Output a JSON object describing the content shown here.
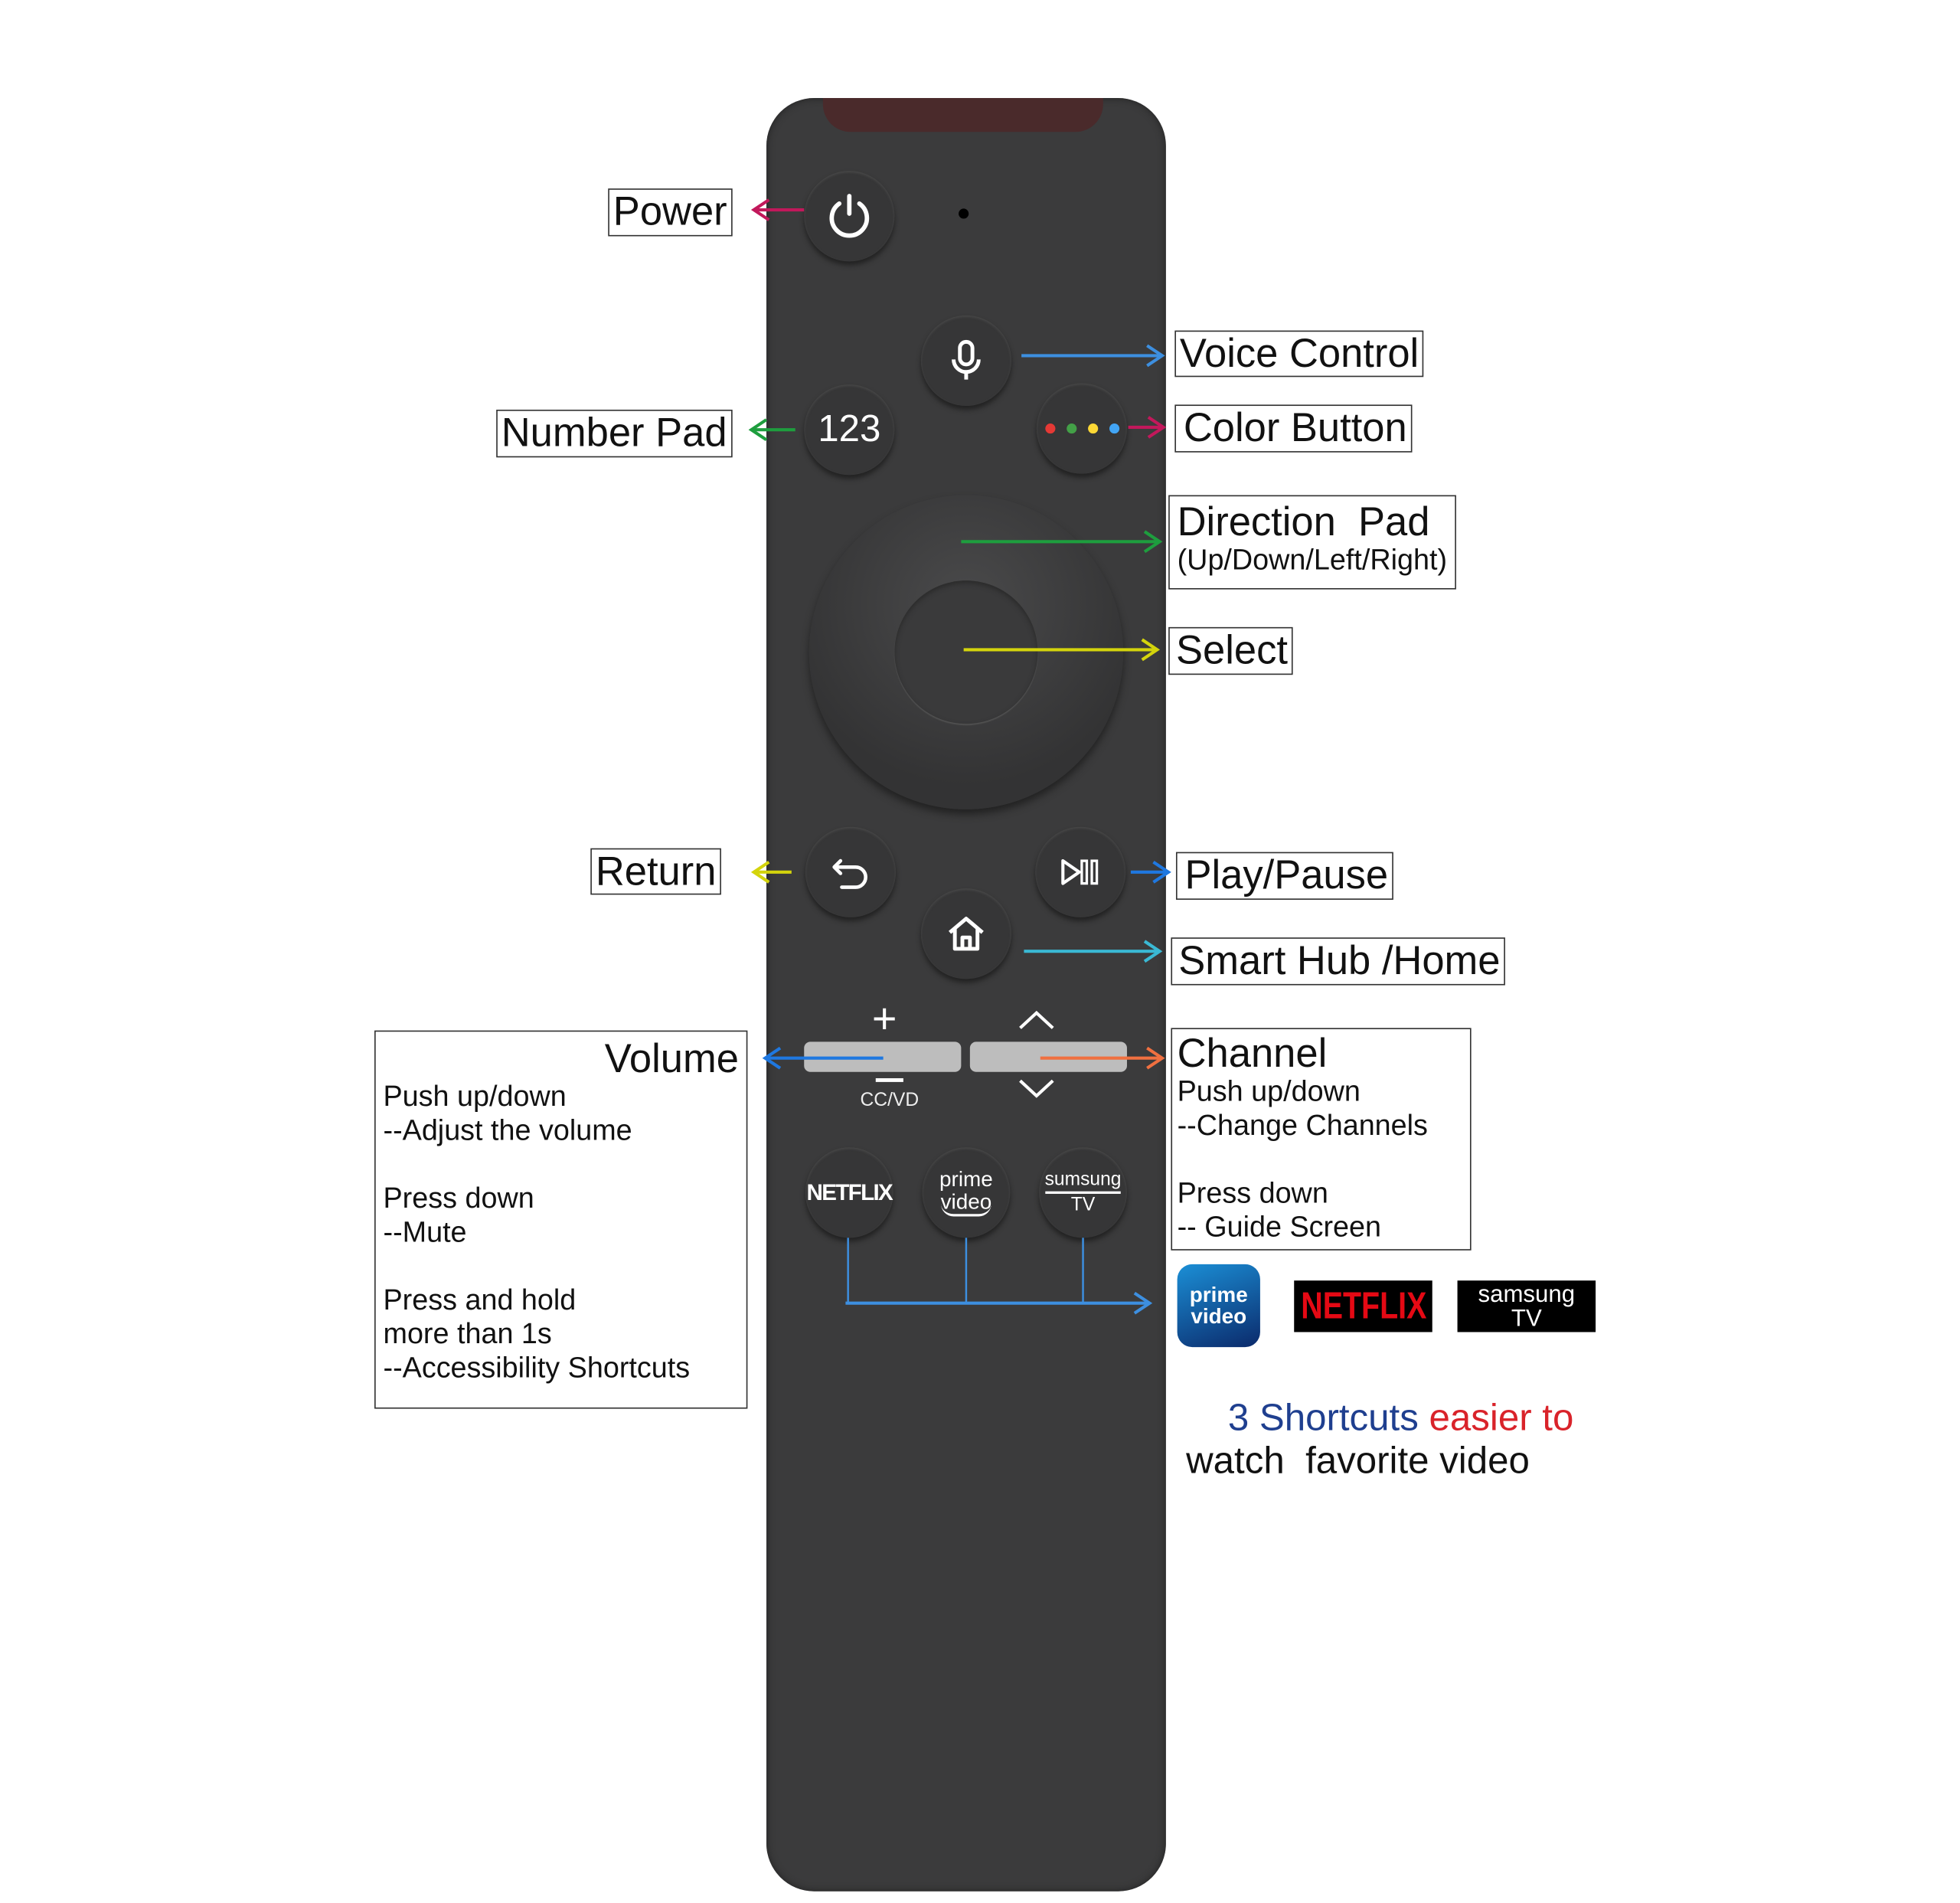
{
  "remote": {
    "number_pad_label": "123",
    "cc_vd_label": "CC/VD",
    "netflix_button": "NETFLIX",
    "prime_button": [
      "prime",
      "video"
    ],
    "samsung_button": [
      "sumsung",
      "TV"
    ],
    "color_dots": [
      "#e53935",
      "#43a047",
      "#fdd835",
      "#42a5f5"
    ],
    "body_color": "#3b3b3c"
  },
  "labels": {
    "power": "Power",
    "voice": "Voice Control",
    "number_pad": "Number Pad",
    "color_button": "Color Button",
    "direction_title": "Direction  Pad",
    "direction_sub": "(Up/Down/Left/Right)",
    "select": "Select",
    "return": "Return",
    "play_pause": "Play/Pause",
    "home": "Smart Hub /Home",
    "volume": {
      "title": "Volume",
      "lines": [
        "Push up/down",
        "--Adjust the volume",
        "",
        "Press down",
        "--Mute",
        "",
        "Press and hold",
        "more than 1s",
        "--Accessibility Shortcuts"
      ]
    },
    "channel": {
      "title": "Channel",
      "lines": [
        "Push up/down",
        "--Change Channels",
        "",
        "Press down",
        "-- Guide Screen"
      ]
    }
  },
  "logos": {
    "prime": [
      "prime",
      "video"
    ],
    "netflix": "NETFLIX",
    "samsung": [
      "samsung",
      "TV"
    ]
  },
  "tagline": {
    "part1": "3 Shortcuts ",
    "part2": "easier to",
    "line2": "watch  favorite video",
    "color1": "#1f3f8f",
    "color2": "#d9232a"
  }
}
